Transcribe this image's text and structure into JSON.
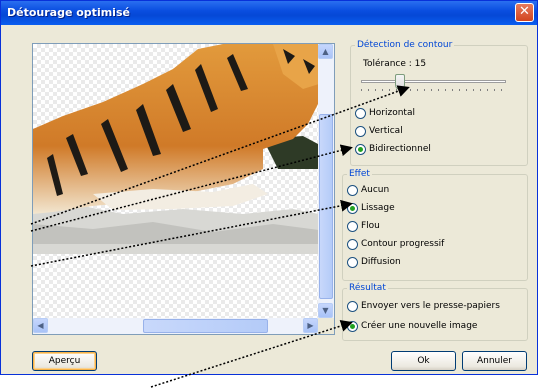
{
  "window": {
    "title": "Détourage optimisé",
    "close_icon": "close-icon"
  },
  "detection": {
    "legend": "Détection de contour",
    "tolerance_label": "Tolérance : 15",
    "tolerance_value": 15,
    "options": [
      "Horizontal",
      "Vertical",
      "Bidirectionnel"
    ],
    "selected": "Bidirectionnel"
  },
  "effet": {
    "legend": "Effet",
    "options": [
      "Aucun",
      "Lissage",
      "Flou",
      "Contour progressif",
      "Diffusion"
    ],
    "selected": "Lissage"
  },
  "resultat": {
    "legend": "Résultat",
    "options": [
      "Envoyer vers le presse-papiers",
      "Créer une nouvelle image"
    ],
    "selected": "Créer une nouvelle image"
  },
  "buttons": {
    "preview": "Aperçu",
    "ok": "Ok",
    "cancel": "Annuler"
  },
  "colors": {
    "titlebar": "#0a4ee0",
    "legend_text": "#0046d5",
    "radio_dot": "#21a121",
    "tiger_orange": "#d4852e"
  }
}
